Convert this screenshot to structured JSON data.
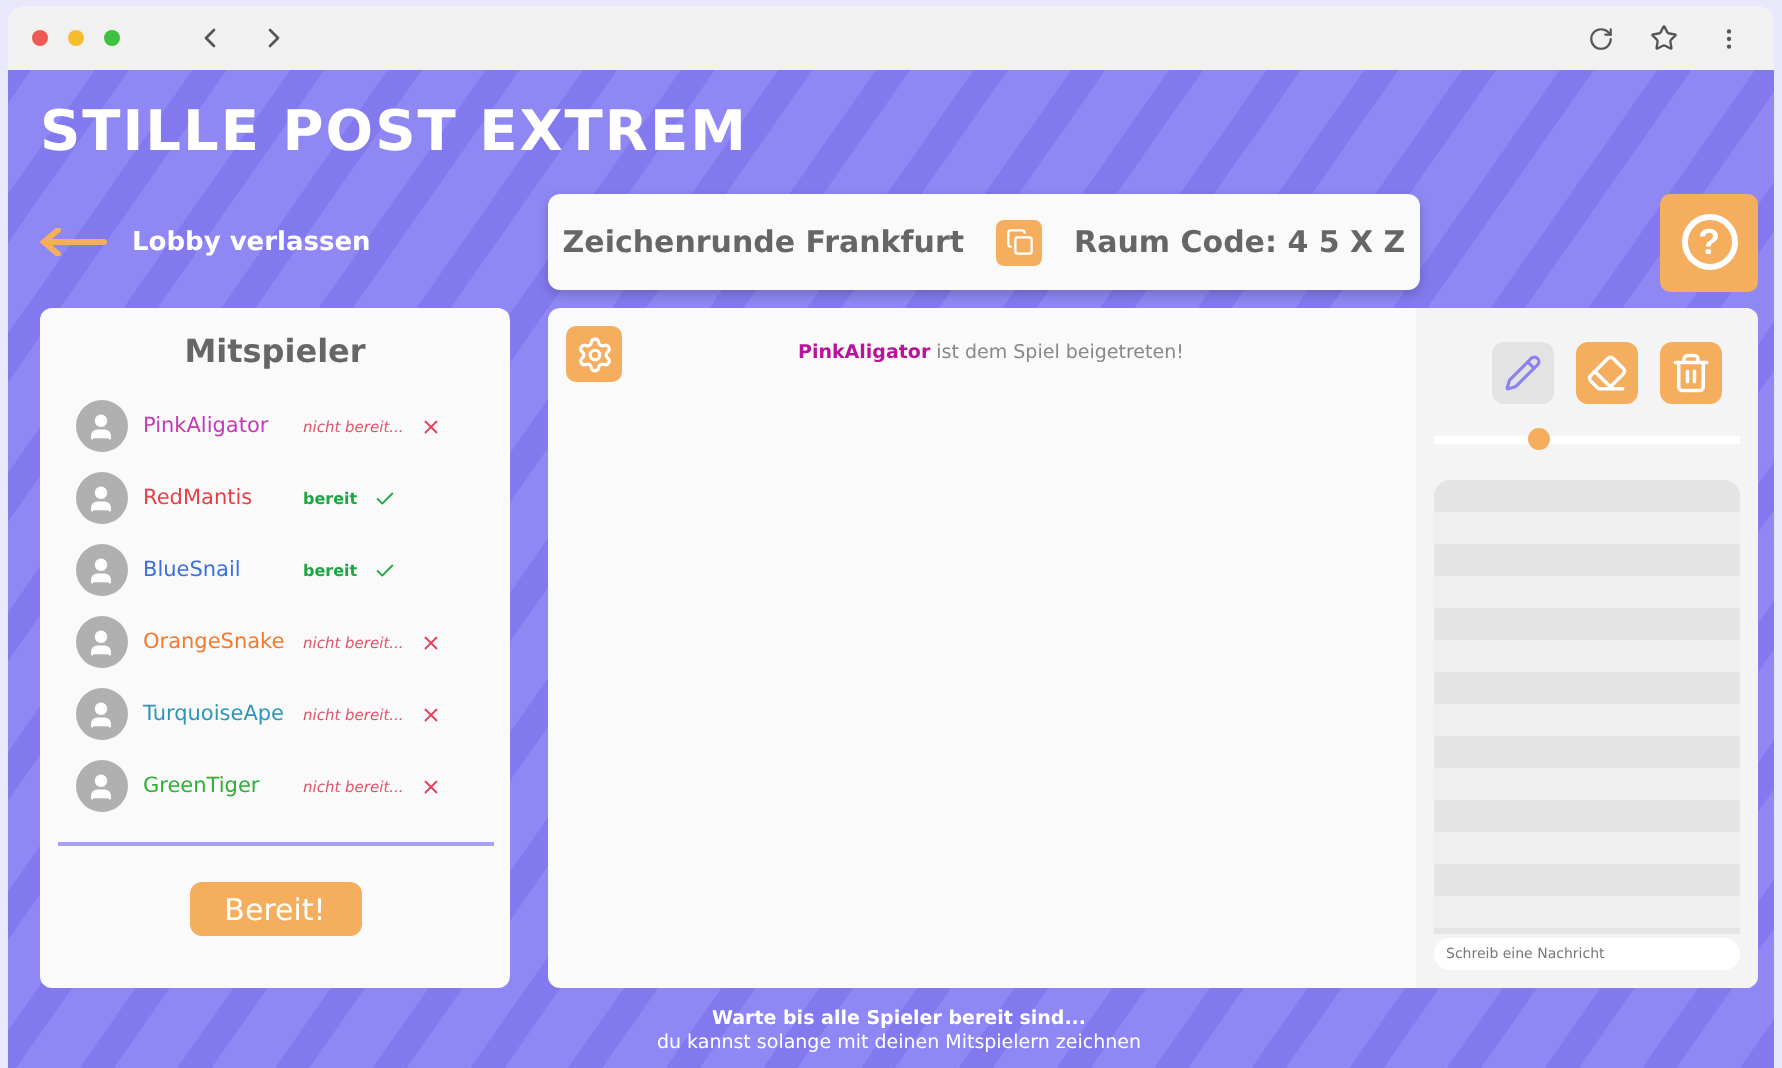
{
  "app_title": "STILLE POST EXTREM",
  "leave_link": "Lobby verlassen",
  "room": {
    "name": "Zeichenrunde Frankfurt",
    "code": "Raum Code: 4 5 X Z"
  },
  "help_button": "?",
  "players_panel": {
    "title": "Mitspieler",
    "button": "Bereit!",
    "players": [
      {
        "name": "PinkAligator",
        "color": "#c33bb4",
        "ready": false,
        "status": "nicht bereit..."
      },
      {
        "name": "RedMantis",
        "color": "#e5404a",
        "ready": true,
        "status": "bereit"
      },
      {
        "name": "BlueSnail",
        "color": "#3a6fe0",
        "ready": true,
        "status": "bereit"
      },
      {
        "name": "OrangeSnake",
        "color": "#f07a30",
        "ready": false,
        "status": "nicht bereit..."
      },
      {
        "name": "TurquoiseApe",
        "color": "#2b96b8",
        "ready": false,
        "status": "nicht bereit..."
      },
      {
        "name": "GreenTiger",
        "color": "#2fae3a",
        "ready": false,
        "status": "nicht bereit..."
      }
    ]
  },
  "canvas": {
    "notice": {
      "player": "PinkAligator",
      "text": "ist dem Spiel beigetreten!"
    }
  },
  "tools": [
    {
      "kind": "pencil",
      "selected": true
    },
    {
      "kind": "eraser",
      "selected": false
    },
    {
      "kind": "trash",
      "selected": false
    }
  ],
  "brush_size": {
    "level": 0.34
  },
  "chat": {
    "placeholder": "Schreib eine Nachricht"
  },
  "footer": {
    "line_1": "Warte bis alle Spieler bereit sind...",
    "line_2": "du kannst solange mit deinen Mitspielern zeichnen"
  }
}
